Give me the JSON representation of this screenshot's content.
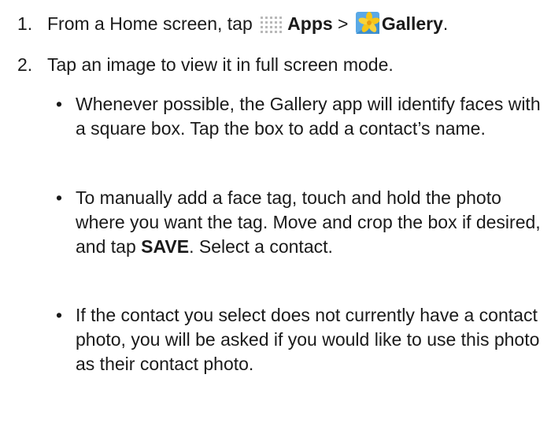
{
  "steps": [
    {
      "number": "1.",
      "prefix": "From a Home screen, tap ",
      "apps_icon": "apps-grid-icon",
      "apps_label": "Apps",
      "separator": " > ",
      "gallery_icon": "gallery-flower-icon",
      "gallery_label": "Gallery",
      "suffix": "."
    },
    {
      "number": "2.",
      "text": "Tap an image to view it in full screen mode."
    }
  ],
  "bullets": [
    {
      "text": "Whenever possible, the Gallery app will identify faces with a square box. Tap the box to add a contact’s name."
    },
    {
      "text_before": "To manually add a face tag, touch and hold the photo where you want the tag. Move and crop the box if desired, and tap ",
      "bold": "SAVE",
      "text_after": ". Select a contact."
    },
    {
      "text": "If the contact you select does not currently have a contact photo, you will be asked if you would like to use this photo as their contact photo."
    }
  ],
  "colors": {
    "text": "#1a1a1a",
    "apps_icon_dot": "#b8b8b8",
    "gallery_blue": "#5aa9e6",
    "gallery_yellow": "#f5c518"
  }
}
